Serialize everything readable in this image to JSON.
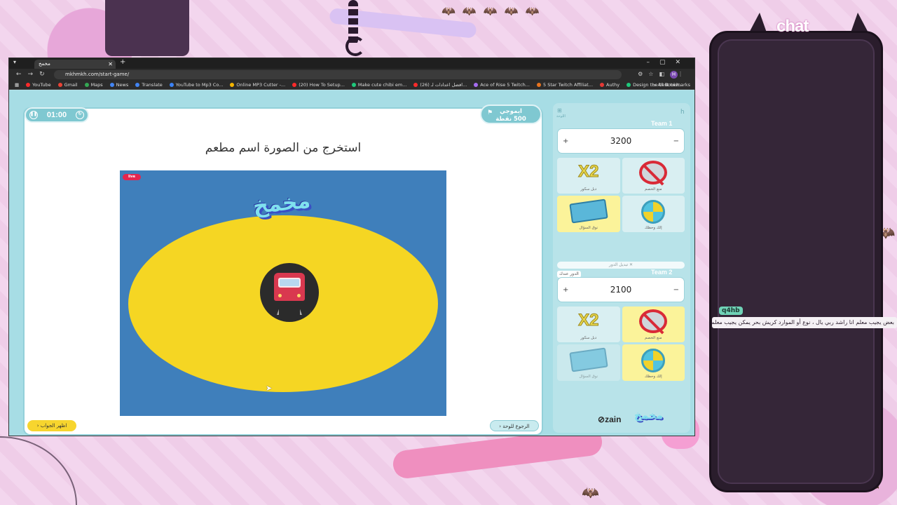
{
  "overlay": {
    "chat_title": "chat",
    "chat_user": "q4hb",
    "chat_message": "بعض يجيب معلم انا راشد ربي يال ، نوع أو الموارد كريش بحر يمكن يجيب معلم كريش"
  },
  "browser": {
    "tab_title": "مخمخ",
    "url": "mkhmkh.com/start-game/",
    "profile_initial": "H",
    "bookmarks": [
      {
        "label": "YouTube",
        "color": "#ff2a2a"
      },
      {
        "label": "Gmail",
        "color": "#ea4335"
      },
      {
        "label": "Maps",
        "color": "#34a853"
      },
      {
        "label": "News",
        "color": "#4285f4"
      },
      {
        "label": "Translate",
        "color": "#4285f4"
      },
      {
        "label": "YouTube to Mp3 Co...",
        "color": "#3b82f6"
      },
      {
        "label": "Online MP3 Cutter -...",
        "color": "#f4b400"
      },
      {
        "label": "(20) How To Setup...",
        "color": "#ff2a2a"
      },
      {
        "label": "Make cute chibi em...",
        "color": "#1ec97c"
      },
      {
        "label": "(26) افضل اعدادات لـ...",
        "color": "#ff2a2a"
      },
      {
        "label": "Ace of Rise 5 Twitch...",
        "color": "#a56cf0"
      },
      {
        "label": "5 Star Twitch Affiliat...",
        "color": "#e8731e"
      },
      {
        "label": "Authy",
        "color": "#e53935"
      },
      {
        "label": "Design the best twit...",
        "color": "#1ec97c"
      }
    ],
    "all_bookmarks": "All Bookmarks"
  },
  "game": {
    "timer": "01:00",
    "category_name": "ايموجي",
    "category_points": "500 نقطة",
    "question": "استخرج من الصورة اسم مطعم",
    "image_logo_text": "مخمخ",
    "live_badge": "live",
    "emoji_icon": "train-icon",
    "show_answer_label": "اظهر الجواب",
    "back_to_board_label": "الرجوع للوحة"
  },
  "side": {
    "top_label": "اللوحة",
    "h_label": "h",
    "team1": {
      "name": "Team 1",
      "score": "3200",
      "powerups": [
        {
          "label": "دبل سكور",
          "icon": "x2-icon",
          "state": "normal"
        },
        {
          "label": "منع الخصم",
          "icon": "ban-icon",
          "state": "normal"
        },
        {
          "label": "نوق السؤال",
          "icon": "cards-icon",
          "state": "active"
        },
        {
          "label": "إلك وحظك",
          "icon": "wheel-icon",
          "state": "normal"
        }
      ]
    },
    "switch_turn": "✕ تبديل الدور",
    "your_turn": "الدور عندك",
    "team2": {
      "name": "Team 2",
      "score": "2100",
      "powerups": [
        {
          "label": "دبل سكور",
          "icon": "x2-icon",
          "state": "normal"
        },
        {
          "label": "منع الخصم",
          "icon": "ban-icon",
          "state": "active"
        },
        {
          "label": "نوق السؤال",
          "icon": "cards-icon",
          "state": "faded"
        },
        {
          "label": "إلك وحظك",
          "icon": "wheel-icon",
          "state": "active"
        }
      ]
    },
    "sponsor": "zain",
    "brand": "مخمخ"
  }
}
